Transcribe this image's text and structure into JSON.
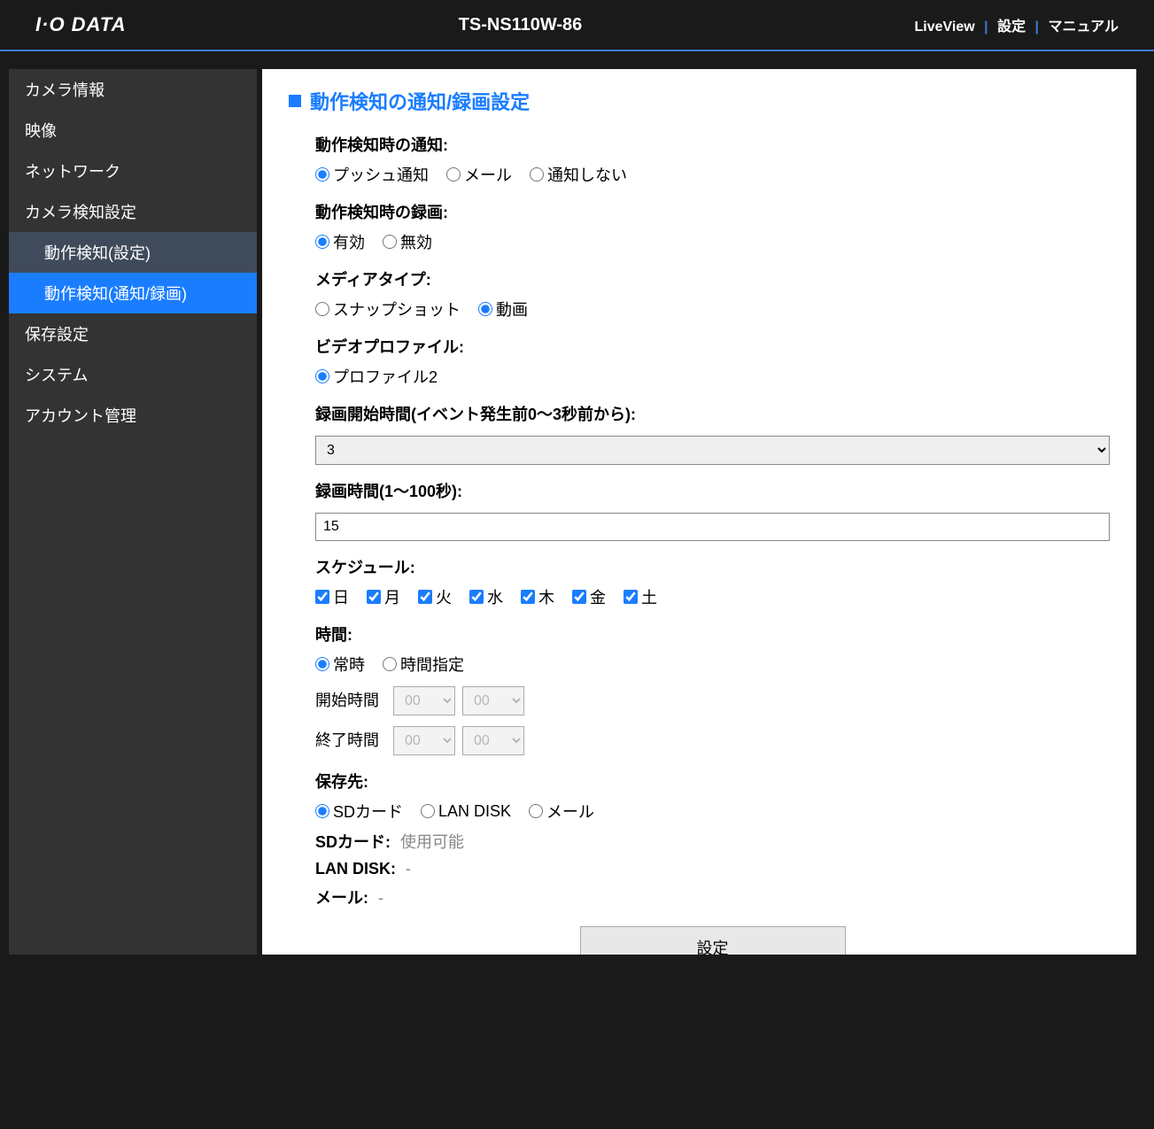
{
  "header": {
    "logo": "I·O DATA",
    "device": "TS-NS110W-86",
    "links": {
      "liveview": "LiveView",
      "settings": "設定",
      "manual": "マニュアル"
    }
  },
  "sidebar": {
    "items": [
      {
        "label": "カメラ情報"
      },
      {
        "label": "映像"
      },
      {
        "label": "ネットワーク"
      },
      {
        "label": "カメラ検知設定"
      },
      {
        "label": "動作検知(設定)",
        "sub": true,
        "cls": "sub1"
      },
      {
        "label": "動作検知(通知/録画)",
        "sub": true,
        "cls": "active"
      },
      {
        "label": "保存設定"
      },
      {
        "label": "システム"
      },
      {
        "label": "アカウント管理"
      }
    ]
  },
  "section": {
    "title": "動作検知の通知/録画設定",
    "notify_label": "動作検知時の通知:",
    "notify_opts": {
      "push": "プッシュ通知",
      "mail": "メール",
      "none": "通知しない"
    },
    "record_label": "動作検知時の録画:",
    "record_opts": {
      "on": "有効",
      "off": "無効"
    },
    "media_label": "メディアタイプ:",
    "media_opts": {
      "snapshot": "スナップショット",
      "video": "動画"
    },
    "profile_label": "ビデオプロファイル:",
    "profile_opts": {
      "p2": "プロファイル2"
    },
    "prerecord_label": "録画開始時間(イベント発生前0〜3秒前から):",
    "prerecord_value": "3",
    "duration_label": "録画時間(1〜100秒):",
    "duration_value": "15",
    "schedule_label": "スケジュール:",
    "days": {
      "sun": "日",
      "mon": "月",
      "tue": "火",
      "wed": "水",
      "thu": "木",
      "fri": "金",
      "sat": "土"
    },
    "time_label": "時間:",
    "time_opts": {
      "always": "常時",
      "specify": "時間指定"
    },
    "start_label": "開始時間",
    "end_label": "終了時間",
    "hour_val": "00",
    "min_val": "00",
    "dest_label": "保存先:",
    "dest_opts": {
      "sd": "SDカード",
      "landisk": "LAN DISK",
      "mail": "メール"
    },
    "sd_status_label": "SDカード:",
    "sd_status_value": "使用可能",
    "landisk_status_label": "LAN DISK:",
    "landisk_status_value": "-",
    "mail_status_label": "メール:",
    "mail_status_value": "-",
    "submit": "設定"
  }
}
